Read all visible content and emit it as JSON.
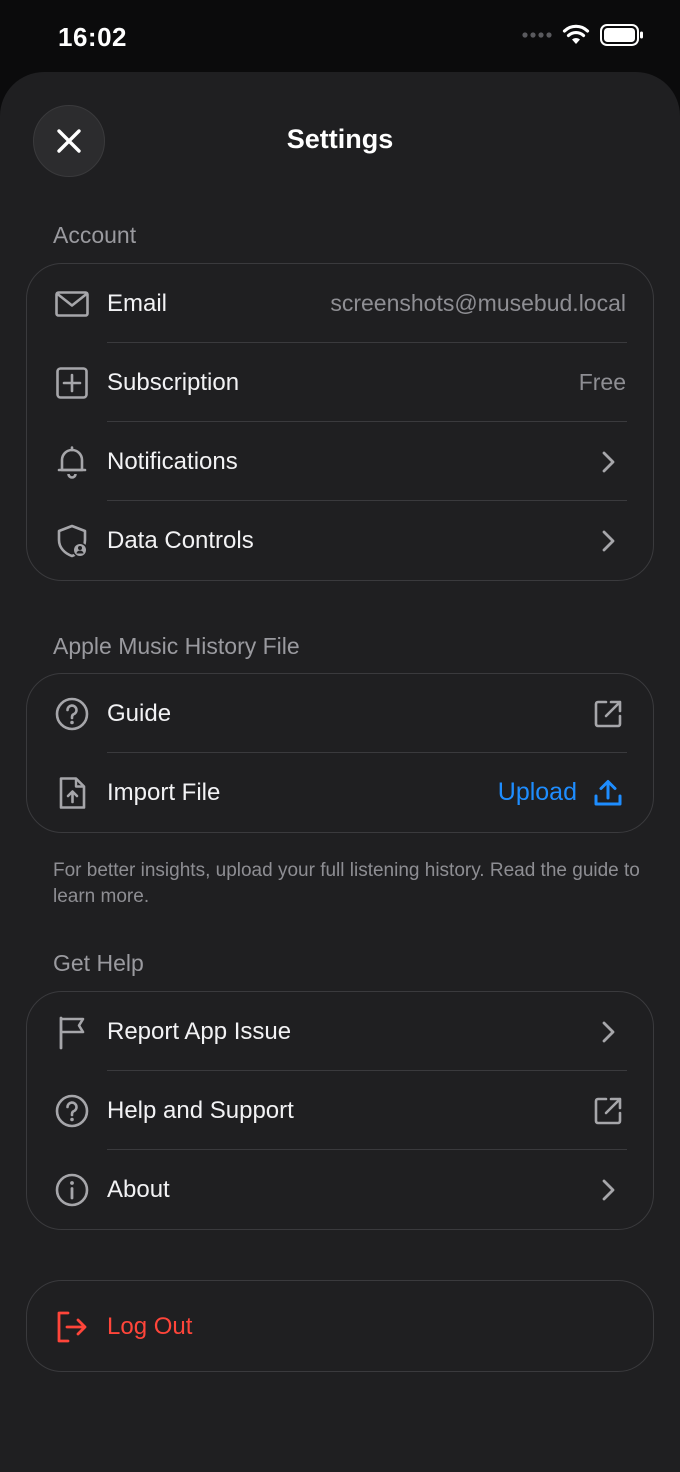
{
  "status_bar": {
    "time": "16:02"
  },
  "header": {
    "title": "Settings"
  },
  "sections": {
    "account": {
      "label": "Account",
      "email_label": "Email",
      "email_value": "screenshots@musebud.local",
      "subscription_label": "Subscription",
      "subscription_value": "Free",
      "notifications_label": "Notifications",
      "data_controls_label": "Data Controls"
    },
    "history": {
      "label": "Apple Music History File",
      "guide_label": "Guide",
      "import_label": "Import File",
      "upload_label": "Upload",
      "note": "For better insights, upload your full listening history. Read the guide to learn more."
    },
    "help": {
      "label": "Get Help",
      "report_label": "Report App Issue",
      "support_label": "Help and Support",
      "about_label": "About"
    }
  },
  "logout": {
    "label": "Log Out"
  },
  "colors": {
    "accent": "#1e8dff",
    "danger": "#ff453a",
    "background": "#1f1f21"
  }
}
